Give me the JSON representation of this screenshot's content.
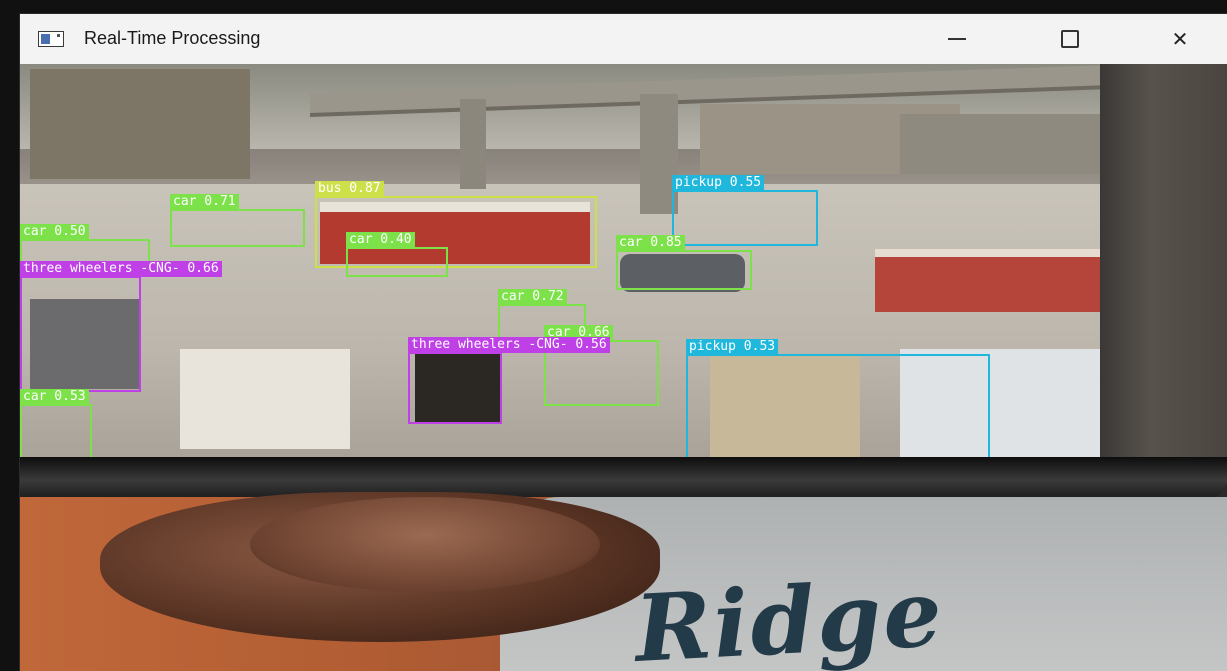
{
  "window": {
    "title": "Real-Time Processing",
    "controls": {
      "minimize": "—",
      "maximize": "☐",
      "close": "✕"
    }
  },
  "shirt_text": "Ridge",
  "detections": [
    {
      "label": "car 0.71",
      "class": "car",
      "confidence": 0.71
    },
    {
      "label": "bus 0.87",
      "class": "bus",
      "confidence": 0.87
    },
    {
      "label": "pickup 0.55",
      "class": "pickup",
      "confidence": 0.55
    },
    {
      "label": "car 0.50",
      "class": "car",
      "confidence": 0.5
    },
    {
      "label": "car 0.40",
      "class": "car",
      "confidence": 0.4
    },
    {
      "label": "car 0.85",
      "class": "car",
      "confidence": 0.85
    },
    {
      "label": "three wheelers -CNG- 0.66",
      "class": "three wheelers -CNG-",
      "confidence": 0.66
    },
    {
      "label": "car 0.72",
      "class": "car",
      "confidence": 0.72
    },
    {
      "label": "car 0.66",
      "class": "car",
      "confidence": 0.66
    },
    {
      "label": "three wheelers -CNG- 0.56",
      "class": "three wheelers -CNG-",
      "confidence": 0.56
    },
    {
      "label": "pickup 0.53",
      "class": "pickup",
      "confidence": 0.53
    },
    {
      "label": "car 0.53",
      "class": "car",
      "confidence": 0.53
    }
  ],
  "colors": {
    "car": "#7de24a",
    "bus": "#cde04a",
    "pickup": "#1fb8dc",
    "three_wheeler": "#c040e8",
    "titlebar": "#f3f3f3"
  }
}
